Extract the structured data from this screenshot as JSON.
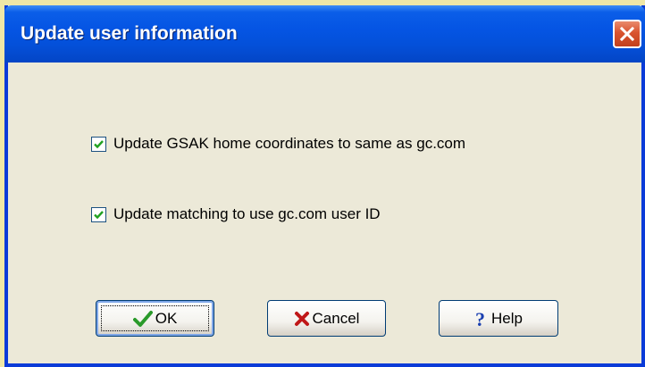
{
  "dialog": {
    "title": "Update user information",
    "options": [
      {
        "label": "Update GSAK home coordinates to same as gc.com",
        "checked": true
      },
      {
        "label": "Update matching to use gc.com user ID",
        "checked": true
      }
    ],
    "buttons": {
      "ok": "OK",
      "cancel": "Cancel",
      "help": "Help"
    }
  },
  "colors": {
    "titlebar": "#0555e4",
    "dialog_bg": "#ece9d8",
    "close_button": "#d9532f",
    "ok_icon": "#2a9a2a",
    "cancel_icon": "#c01818",
    "help_icon": "#1a3fb0"
  },
  "icons": {
    "ok": "checkmark-icon",
    "cancel": "x-icon",
    "help": "question-mark-icon",
    "close": "close-icon"
  }
}
